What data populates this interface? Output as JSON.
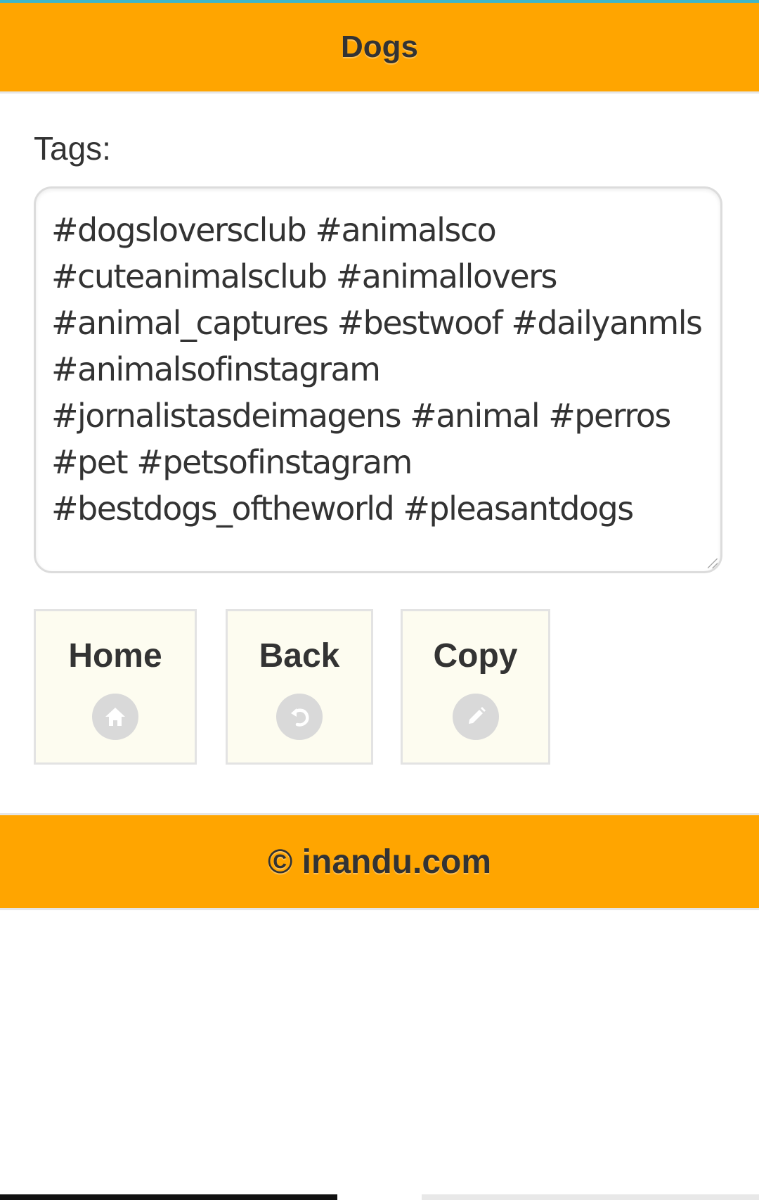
{
  "header": {
    "title": "Dogs"
  },
  "tags": {
    "label": "Tags:",
    "value": "#dogsloversclub #animalsco\n#cuteanimalsclub #animallovers\n#animal_captures #bestwoof #dailyanmls\n#animalsofinstagram\n#jornalistasdeimagens #animal #perros\n#pet #petsofinstagram\n#bestdogs_oftheworld #pleasantdogs"
  },
  "buttons": {
    "home_label": "Home",
    "home_icon": "home-icon",
    "back_label": "Back",
    "back_icon": "back-arrow-icon",
    "copy_label": "Copy",
    "copy_icon": "pencil-icon"
  },
  "footer": {
    "text": "© inandu.com"
  },
  "colors": {
    "accent": "#ffa500",
    "button_bg": "#fdfcf0",
    "icon_bg": "#d9d9d9"
  }
}
